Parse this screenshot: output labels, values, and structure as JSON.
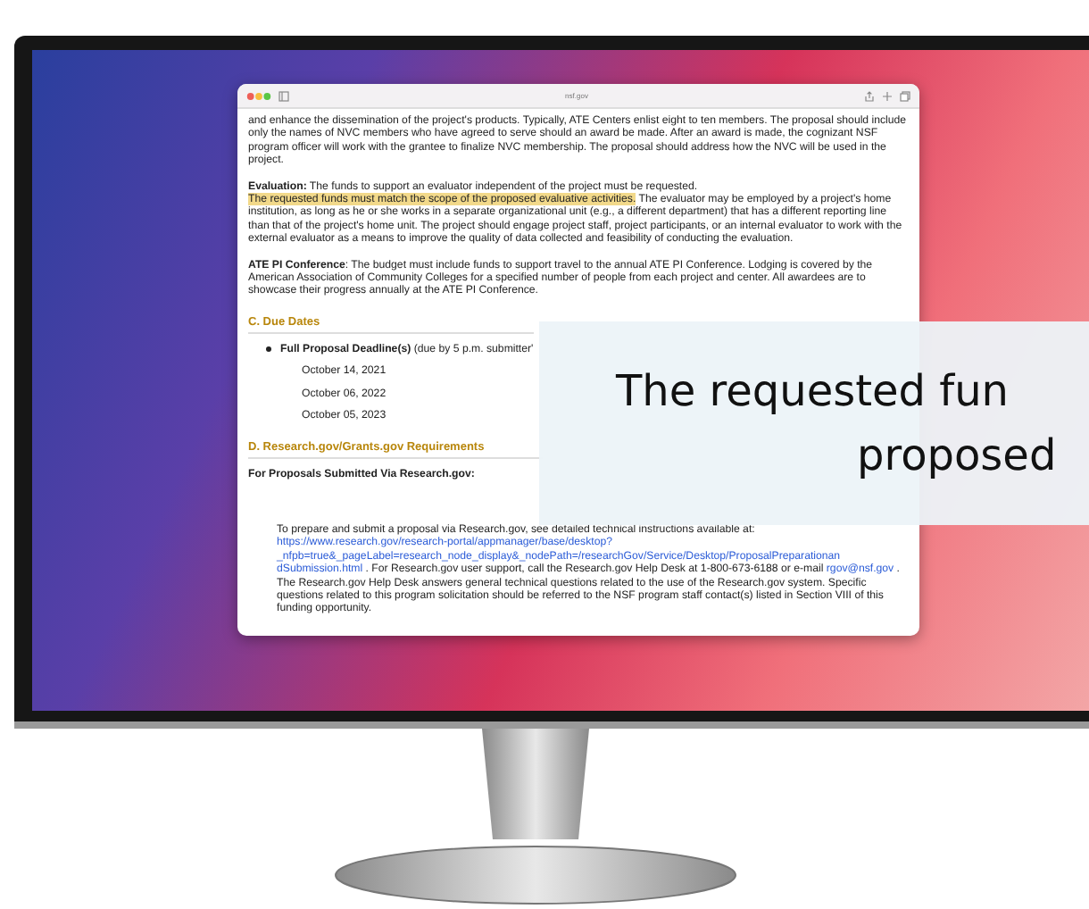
{
  "browser": {
    "url": "nsf.gov"
  },
  "paragraphs": [
    {
      "segments": [
        {
          "text": "and enhance the dissemination of the project's products. Typically, ATE Centers enlist eight to ten members. The proposal should include only the names of NVC members who have agreed to serve should an award be made. After an award is made, the cognizant NSF program officer will work with the grantee to finalize NVC membership. The proposal should address how the NVC will be used in the project.",
          "highlighted": false
        }
      ]
    },
    {
      "lead": "Evaluation:",
      "segments": [
        {
          "text": " The funds to support an evaluator independent of the project must be requested. ",
          "highlighted": false
        },
        {
          "text": "The requested funds must ",
          "highlighted": true
        },
        {
          "text": "match the scope of the proposed evaluative activities.",
          "highlighted": true
        },
        {
          "text": " The evaluator may be employed by a project's home institution, as long as he or she works in a separate organizational unit (e.g., a different department) that has a different reporting line than that of the project's home unit. The project should engage project staff, project participants, or an internal evaluator to work with the external evaluator as a means to improve the quality of data collected and feasibility of conducting the evaluation.",
          "highlighted": false
        }
      ]
    },
    {
      "lead": "ATE PI Conference",
      "segments": [
        {
          "text": ": The budget must include funds to support travel to the annual ATE PI Conference. Lodging is covered by the American Association of Community Colleges for a specified number of people from each project and center. All awardees are to showcase their progress annually at the ATE PI Conference.",
          "highlighted": false
        }
      ]
    }
  ],
  "due_dates": {
    "heading": "C. Due Dates",
    "item_label": "Full Proposal Deadline(s)",
    "item_note": "(due by 5 p.m. submitter'",
    "dates": [
      "October 14, 2021",
      "October 06, 2022",
      "October 05, 2023"
    ]
  },
  "requirements": {
    "heading": "D. Research.gov/Grants.gov Requirements",
    "subheading": "For Proposals Submitted Via Research.gov:",
    "segments": [
      {
        "kind": "text",
        "text": "To prepare and submit a proposal via Research.gov, see detailed technical instructions available at: "
      },
      {
        "kind": "link",
        "text": "https://www.research.gov/research-portal/appmanager/base/desktop?"
      },
      {
        "kind": "link",
        "text": "_nfpb=true&_pageLabel=research_node_display&_nodePath=/researchGov/Service/Desktop/ProposalPreparationan"
      },
      {
        "kind": "link",
        "text": "dSubmission.html"
      },
      {
        "kind": "text",
        "text": ". For Research.gov user support, call the Research.gov Help Desk at 1-800-673-6188 or e-mail "
      },
      {
        "kind": "link",
        "text": "rgov@nsf.gov"
      },
      {
        "kind": "text",
        "text": ". The Research.gov Help Desk answers general technical questions related to the use of the Research.gov system. Specific questions related to this program solicitation should be referred to the NSF program staff contact(s) listed in Section VIII of this funding opportunity."
      }
    ]
  },
  "callout": {
    "lines": [
      "The requested fun",
      "proposed"
    ]
  }
}
